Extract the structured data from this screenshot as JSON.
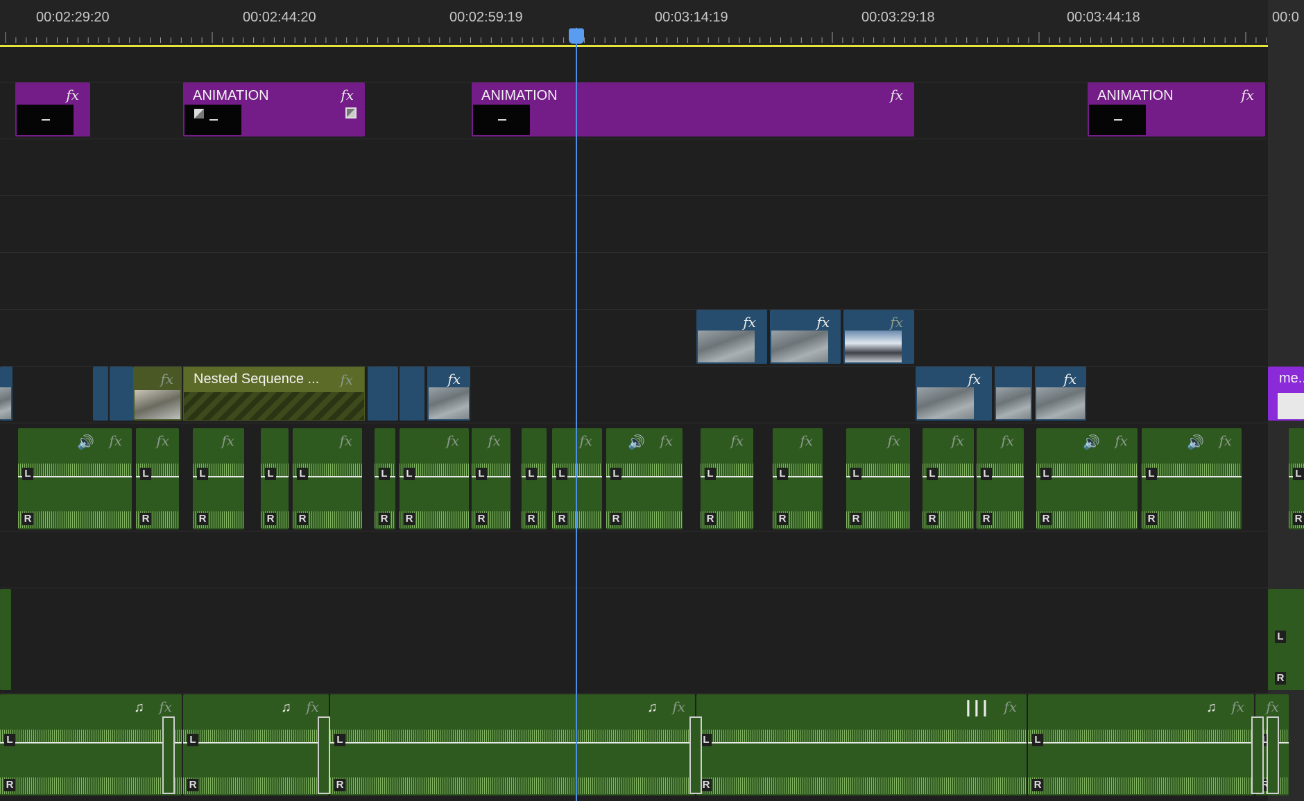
{
  "ruler": {
    "timecodes": [
      "00:02:29:20",
      "00:02:44:20",
      "00:02:59:19",
      "00:03:14:19",
      "00:03:29:18",
      "00:03:44:18",
      "00:0"
    ]
  },
  "clips": {
    "animation_label": "ANIMATION",
    "nested_label": "Nested Sequence ...",
    "cut_label": "me..",
    "fx": "fx",
    "left_channel": "L",
    "right_channel": "R"
  },
  "colors": {
    "graphics_clip": "#741c88",
    "video_clip": "#264d6e",
    "audio_clip": "#2f5a1f",
    "playhead": "#4e8fe6",
    "work_area": "#e4e43a"
  },
  "icons": {
    "music": "♫",
    "voice": "🔊",
    "waveform": "┃┃┃"
  }
}
